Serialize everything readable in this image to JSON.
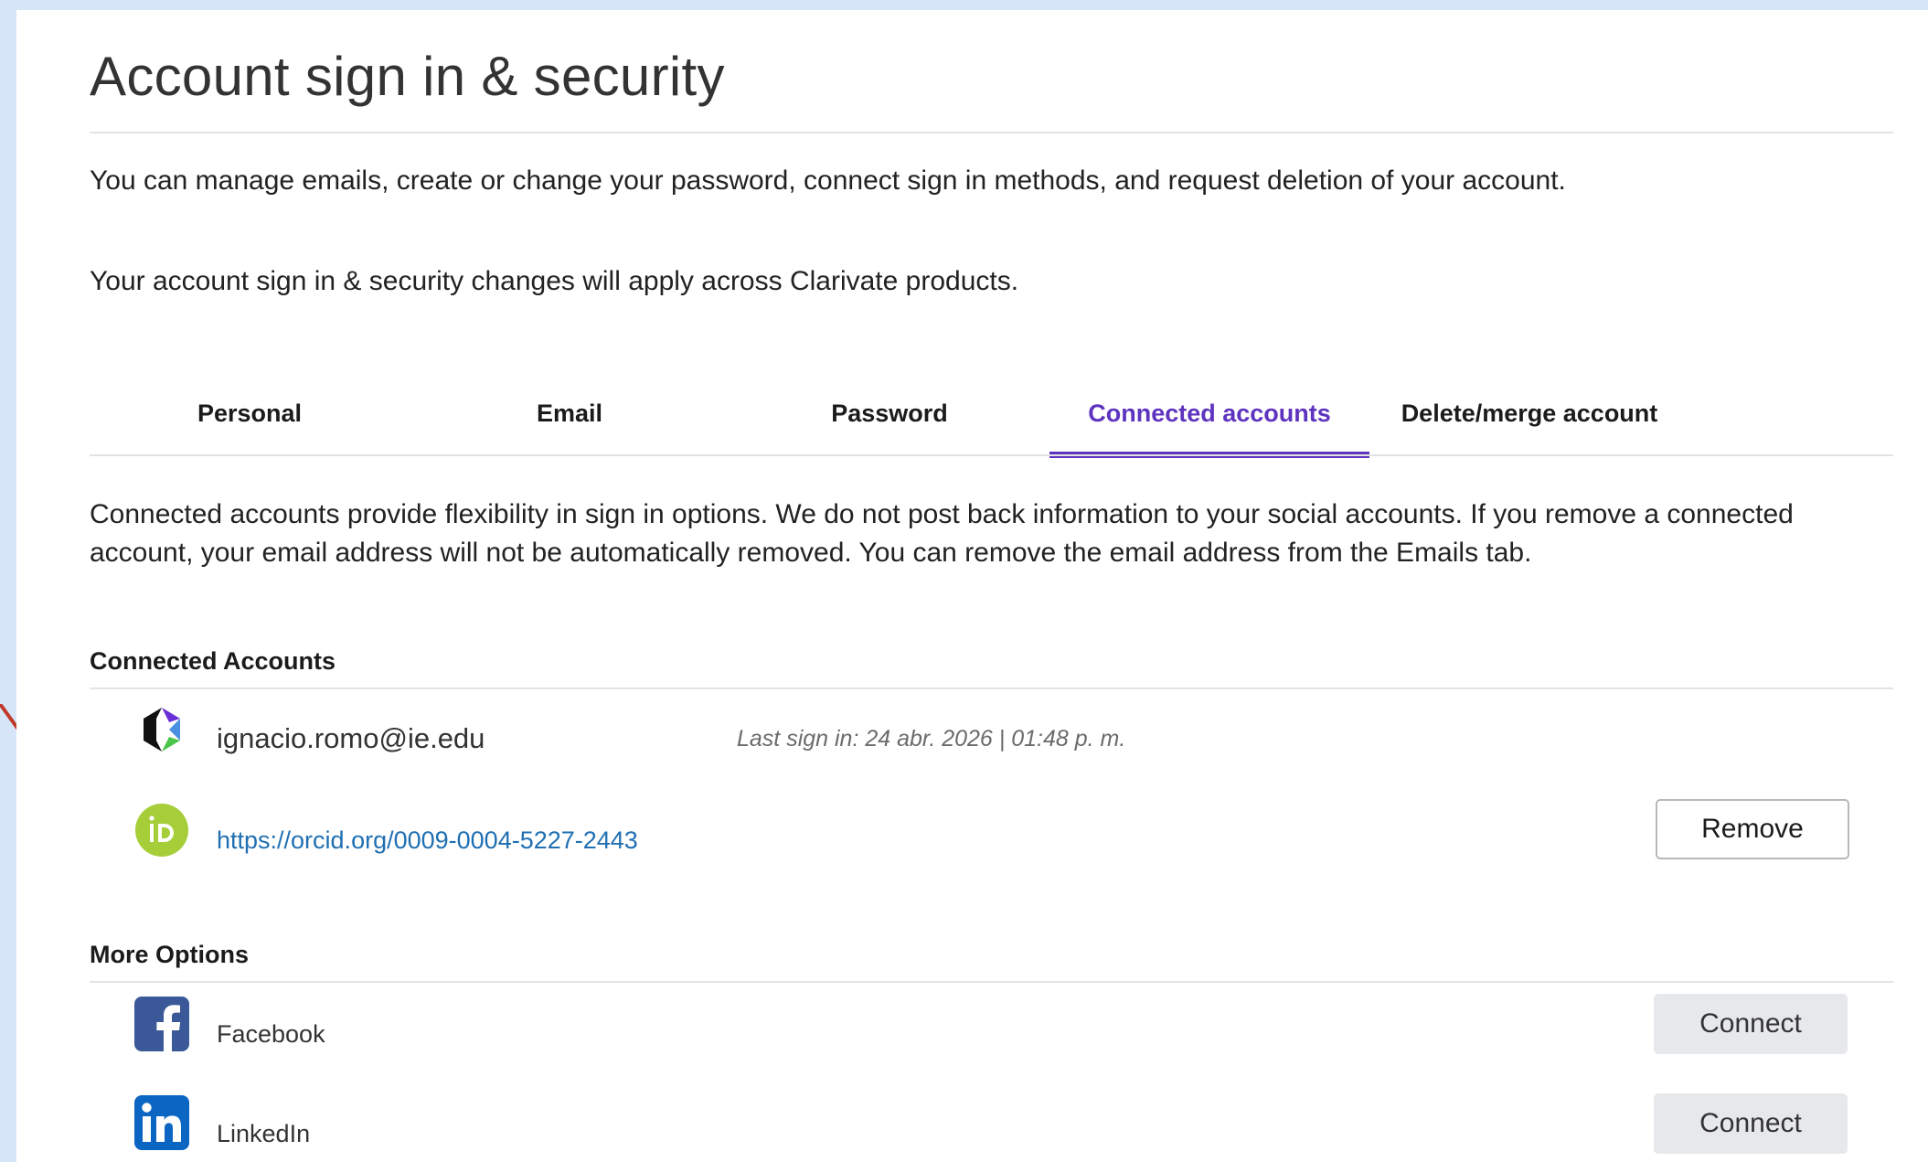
{
  "header": {
    "title": "Account sign in & security"
  },
  "intro": {
    "line1": "You can manage emails, create or change your password, connect sign in methods, and request deletion of your account.",
    "line2": "Your account sign in & security changes will apply across Clarivate products."
  },
  "tabs": [
    {
      "label": "Personal",
      "active": false
    },
    {
      "label": "Email",
      "active": false
    },
    {
      "label": "Password",
      "active": false
    },
    {
      "label": "Connected accounts",
      "active": true
    },
    {
      "label": "Delete/merge account",
      "active": false
    }
  ],
  "connected": {
    "description_line1": "Connected accounts provide flexibility in sign in options. We do not post back information to your social accounts. If you remove a connected",
    "description_line2": "account, your email address will not be automatically removed. You can remove the email address from the Emails tab.",
    "section_title": "Connected Accounts",
    "accounts": [
      {
        "icon": "clarivate-logo-icon",
        "label": "ignacio.romo@ie.edu",
        "last_sign_in": "Last sign in: 24 abr. 2026 | 01:48 p. m."
      },
      {
        "icon": "orcid-icon",
        "label": "https://orcid.org/0009-0004-5227-2443",
        "button": "Remove"
      }
    ]
  },
  "more_options": {
    "section_title": "More Options",
    "items": [
      {
        "icon": "facebook-icon",
        "label": "Facebook",
        "button": "Connect"
      },
      {
        "icon": "linkedin-icon",
        "label": "LinkedIn",
        "button": "Connect"
      }
    ]
  },
  "colors": {
    "accent": "#5e33bf",
    "link": "#1f6fb2",
    "orcid": "#a6ce39",
    "facebook": "#3b5998",
    "linkedin": "#0a66c2",
    "annotation_arrow": "#c0392b"
  }
}
